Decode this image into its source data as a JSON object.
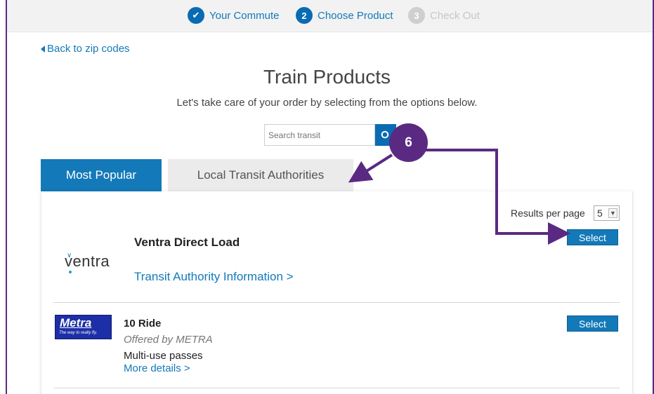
{
  "stepper": {
    "steps": [
      {
        "label": "Your Commute",
        "state": "done",
        "marker": "✔"
      },
      {
        "label": "Choose Product",
        "state": "active",
        "marker": "2"
      },
      {
        "label": "Check Out",
        "state": "pending",
        "marker": "3"
      }
    ]
  },
  "nav": {
    "back_label": "Back to zip codes"
  },
  "header": {
    "title": "Train Products",
    "subtitle": "Let's take care of your order by selecting from the options below."
  },
  "search": {
    "placeholder": "Search transit",
    "button_icon": "search-icon"
  },
  "tabs": [
    {
      "label": "Most Popular",
      "active": true
    },
    {
      "label": "Local Transit Authorities",
      "active": false
    }
  ],
  "results": {
    "per_page_label": "Results per page",
    "per_page_value": "5"
  },
  "products": [
    {
      "logo_text": "ventra",
      "name": "Ventra Direct Load",
      "link": "Transit Authority Information >",
      "select_label": "Select"
    },
    {
      "logo_text": "Metra",
      "logo_tagline": "The way to really fly.",
      "name": "10 Ride",
      "offered_by": "Offered by METRA",
      "description": "Multi-use passes",
      "more_link": "More details >",
      "select_label": "Select"
    }
  ],
  "annotation": {
    "number": "6",
    "color": "#5a2a82"
  },
  "colors": {
    "accent": "#1479b8",
    "annotation": "#5a2a82"
  }
}
